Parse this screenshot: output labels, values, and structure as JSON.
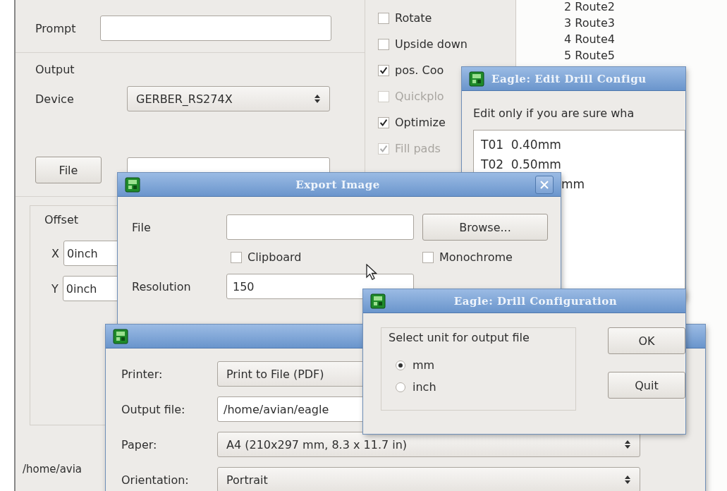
{
  "cam_window": {
    "prompt_label": "Prompt",
    "output_label": "Output",
    "device_label": "Device",
    "device_value": "GERBER_RS274X",
    "file_button": "File",
    "offset_label": "Offset",
    "offset_fields": [
      {
        "axis": "X",
        "value": "0inch"
      },
      {
        "axis": "Y",
        "value": "0inch"
      }
    ],
    "options": [
      {
        "label": "Rotate",
        "checked": false,
        "disabled": false
      },
      {
        "label": "Upside down",
        "checked": false,
        "disabled": false
      },
      {
        "label": "pos. Coo",
        "checked": true,
        "disabled": false
      },
      {
        "label": "Quickplo",
        "checked": false,
        "disabled": true
      },
      {
        "label": "Optimize",
        "checked": true,
        "disabled": false
      },
      {
        "label": "Fill pads",
        "checked": true,
        "disabled": true
      }
    ],
    "layers": [
      {
        "number": "2",
        "name": "Route2"
      },
      {
        "number": "3",
        "name": "Route3"
      },
      {
        "number": "4",
        "name": "Route4"
      },
      {
        "number": "5",
        "name": "Route5"
      }
    ],
    "status_path": "/home/avia"
  },
  "edit_drill_window": {
    "title": "Eagle: Edit Drill Configu",
    "hint": "Edit only if you are sure wha",
    "lines": [
      "T01  0.40mm",
      "T02  0.50mm",
      "mm"
    ]
  },
  "export_image_window": {
    "title": "Export Image",
    "file_label": "File",
    "browse_button": "Browse...",
    "options": [
      {
        "label": "Clipboard",
        "checked": false
      },
      {
        "label": "Monochrome",
        "checked": false
      }
    ],
    "resolution_label": "Resolution",
    "resolution_value": "150"
  },
  "print_window": {
    "fields": [
      {
        "kind": "combo",
        "label": "Printer:",
        "value": "Print to File (PDF)"
      },
      {
        "kind": "text",
        "label": "Output file:",
        "value": "/home/avian/eagle"
      },
      {
        "kind": "combo",
        "label": "Paper:",
        "value": "A4 (210x297 mm, 8.3 x 11.7 in)"
      },
      {
        "kind": "combo",
        "label": "Orientation:",
        "value": "Portrait"
      }
    ]
  },
  "drill_window": {
    "title": "Eagle: Drill Configuration",
    "group_label": "Select unit for output file",
    "units": [
      {
        "label": "mm",
        "selected": true
      },
      {
        "label": "inch",
        "selected": false
      }
    ],
    "buttons": [
      "OK",
      "Quit"
    ]
  }
}
